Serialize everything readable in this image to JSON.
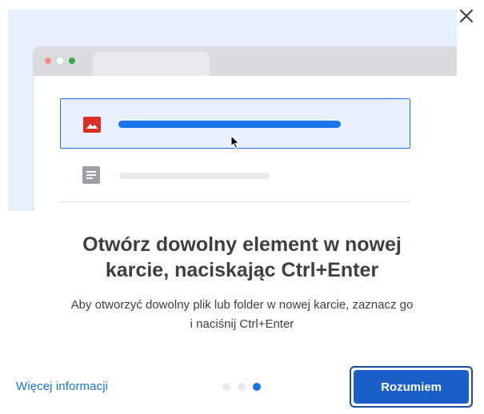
{
  "dialog": {
    "close_icon": "close-icon",
    "illustration": {
      "selected_row_icon": "image-icon",
      "plain_row_icon": "document-icon",
      "cursor_icon": "mouse-pointer-icon",
      "accent_color": "#1a73e8",
      "image_icon_color": "#d93025"
    },
    "title_line1": "Otwórz dowolny element w nowej",
    "title_line2": "karcie, naciskając Ctrl+Enter",
    "description_line1": "Aby otworzyć dowolny plik lub folder w nowej karcie, zaznacz go",
    "description_line2": "i naciśnij Ctrl+Enter",
    "learn_more_label": "Więcej informacji",
    "pager": {
      "total": 3,
      "current": 3
    },
    "got_it_label": "Rozumiem"
  }
}
